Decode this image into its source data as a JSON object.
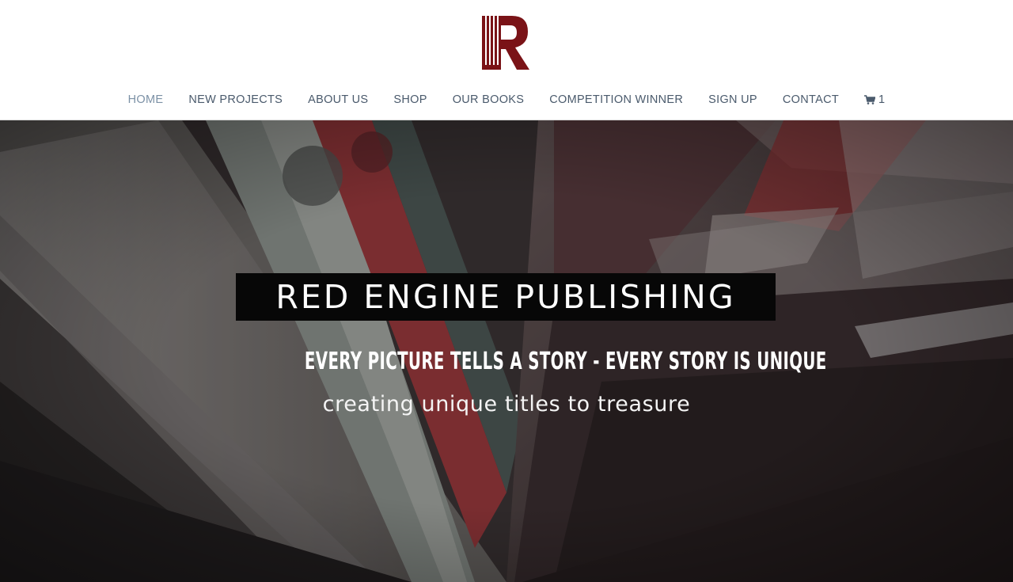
{
  "brand": {
    "logo_letter": "R",
    "logo_color": "#7a1317"
  },
  "nav": {
    "items": [
      {
        "label": "HOME",
        "active": true
      },
      {
        "label": "NEW PROJECTS"
      },
      {
        "label": "ABOUT US"
      },
      {
        "label": "SHOP"
      },
      {
        "label": "OUR BOOKS"
      },
      {
        "label": "COMPETITION WINNER"
      },
      {
        "label": "SIGN UP"
      },
      {
        "label": "CONTACT"
      }
    ],
    "cart": {
      "icon": "cart-icon",
      "count": "1"
    }
  },
  "hero": {
    "title": "RED ENGINE PUBLISHING",
    "tagline": "EVERY PICTURE TELLS A STORY - EVERY STORY IS UNIQUE",
    "subtitle": "creating unique titles to treasure"
  },
  "colors": {
    "nav_text": "#4a5a6c",
    "nav_active": "#7c91a6",
    "title_box": "#070707",
    "hero_text": "#ffffff"
  }
}
